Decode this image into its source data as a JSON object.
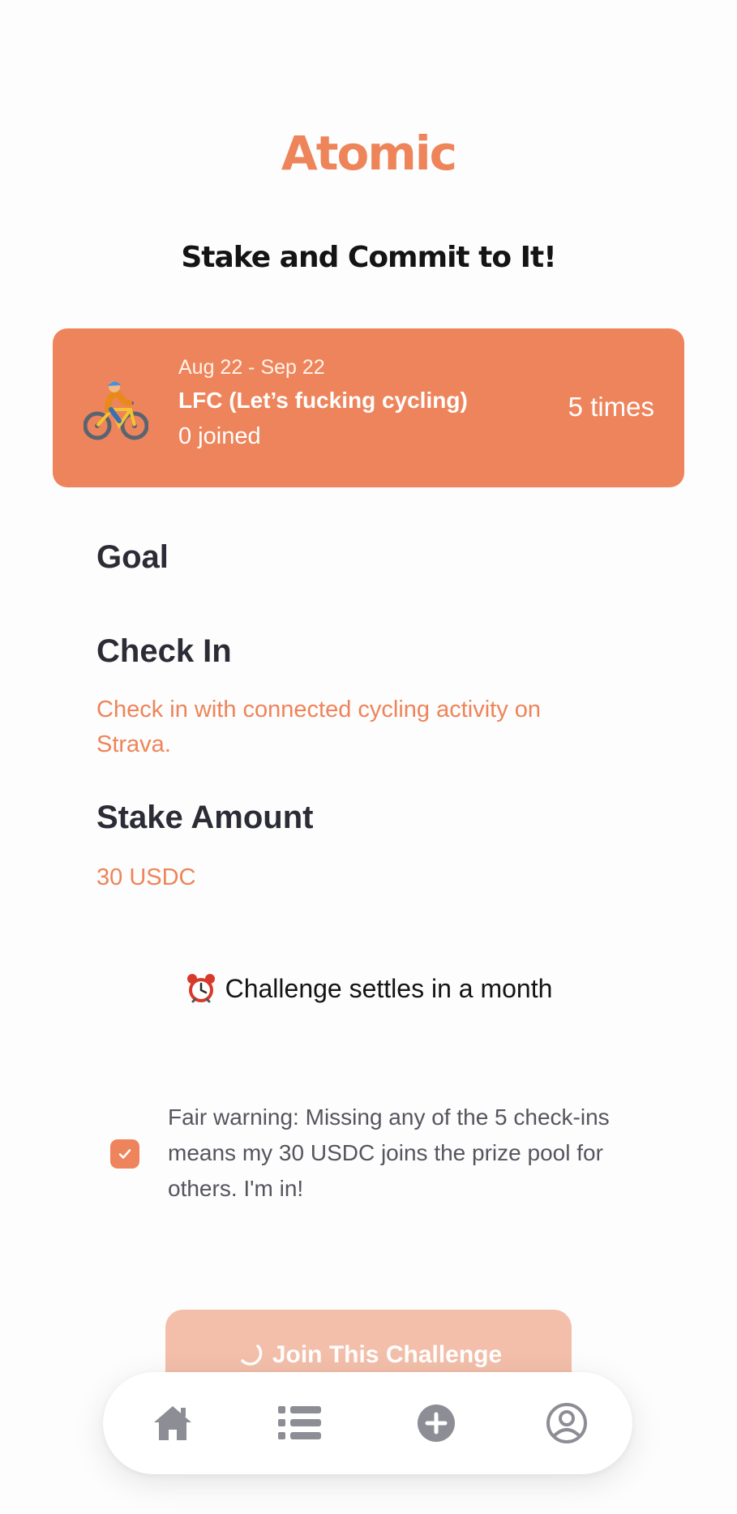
{
  "app": {
    "title": "Atomic",
    "tagline": "Stake and Commit to It!"
  },
  "challenge": {
    "emoji": "person-biking-icon",
    "dates": "Aug 22 - Sep 22",
    "name": "LFC (Let’s fucking cycling)",
    "joined": "0 joined",
    "frequency": "5 times"
  },
  "sections": {
    "goal": {
      "heading": "Goal",
      "text": ""
    },
    "check_in": {
      "heading": "Check In",
      "text": "Check in with connected cycling activity on Strava."
    },
    "stake": {
      "heading": "Stake Amount",
      "text": "30 USDC"
    }
  },
  "settle": {
    "icon": "alarm-clock-icon",
    "text": "Challenge settles in a month"
  },
  "agreement": {
    "checked": true,
    "text": "Fair warning: Missing any of the 5 check-ins means my 30 USDC joins the prize pool for others. I'm in!"
  },
  "join_button": {
    "label": "Join This Challenge",
    "loading": true
  },
  "tab_bar": {
    "items": [
      {
        "icon": "home-icon"
      },
      {
        "icon": "list-icon"
      },
      {
        "icon": "plus-circle-icon"
      },
      {
        "icon": "profile-icon"
      }
    ]
  },
  "colors": {
    "accent": "#ee845b",
    "accent_light": "#f3bfaa",
    "heading": "#2c2c36",
    "icon_gray": "#8d8d95"
  }
}
